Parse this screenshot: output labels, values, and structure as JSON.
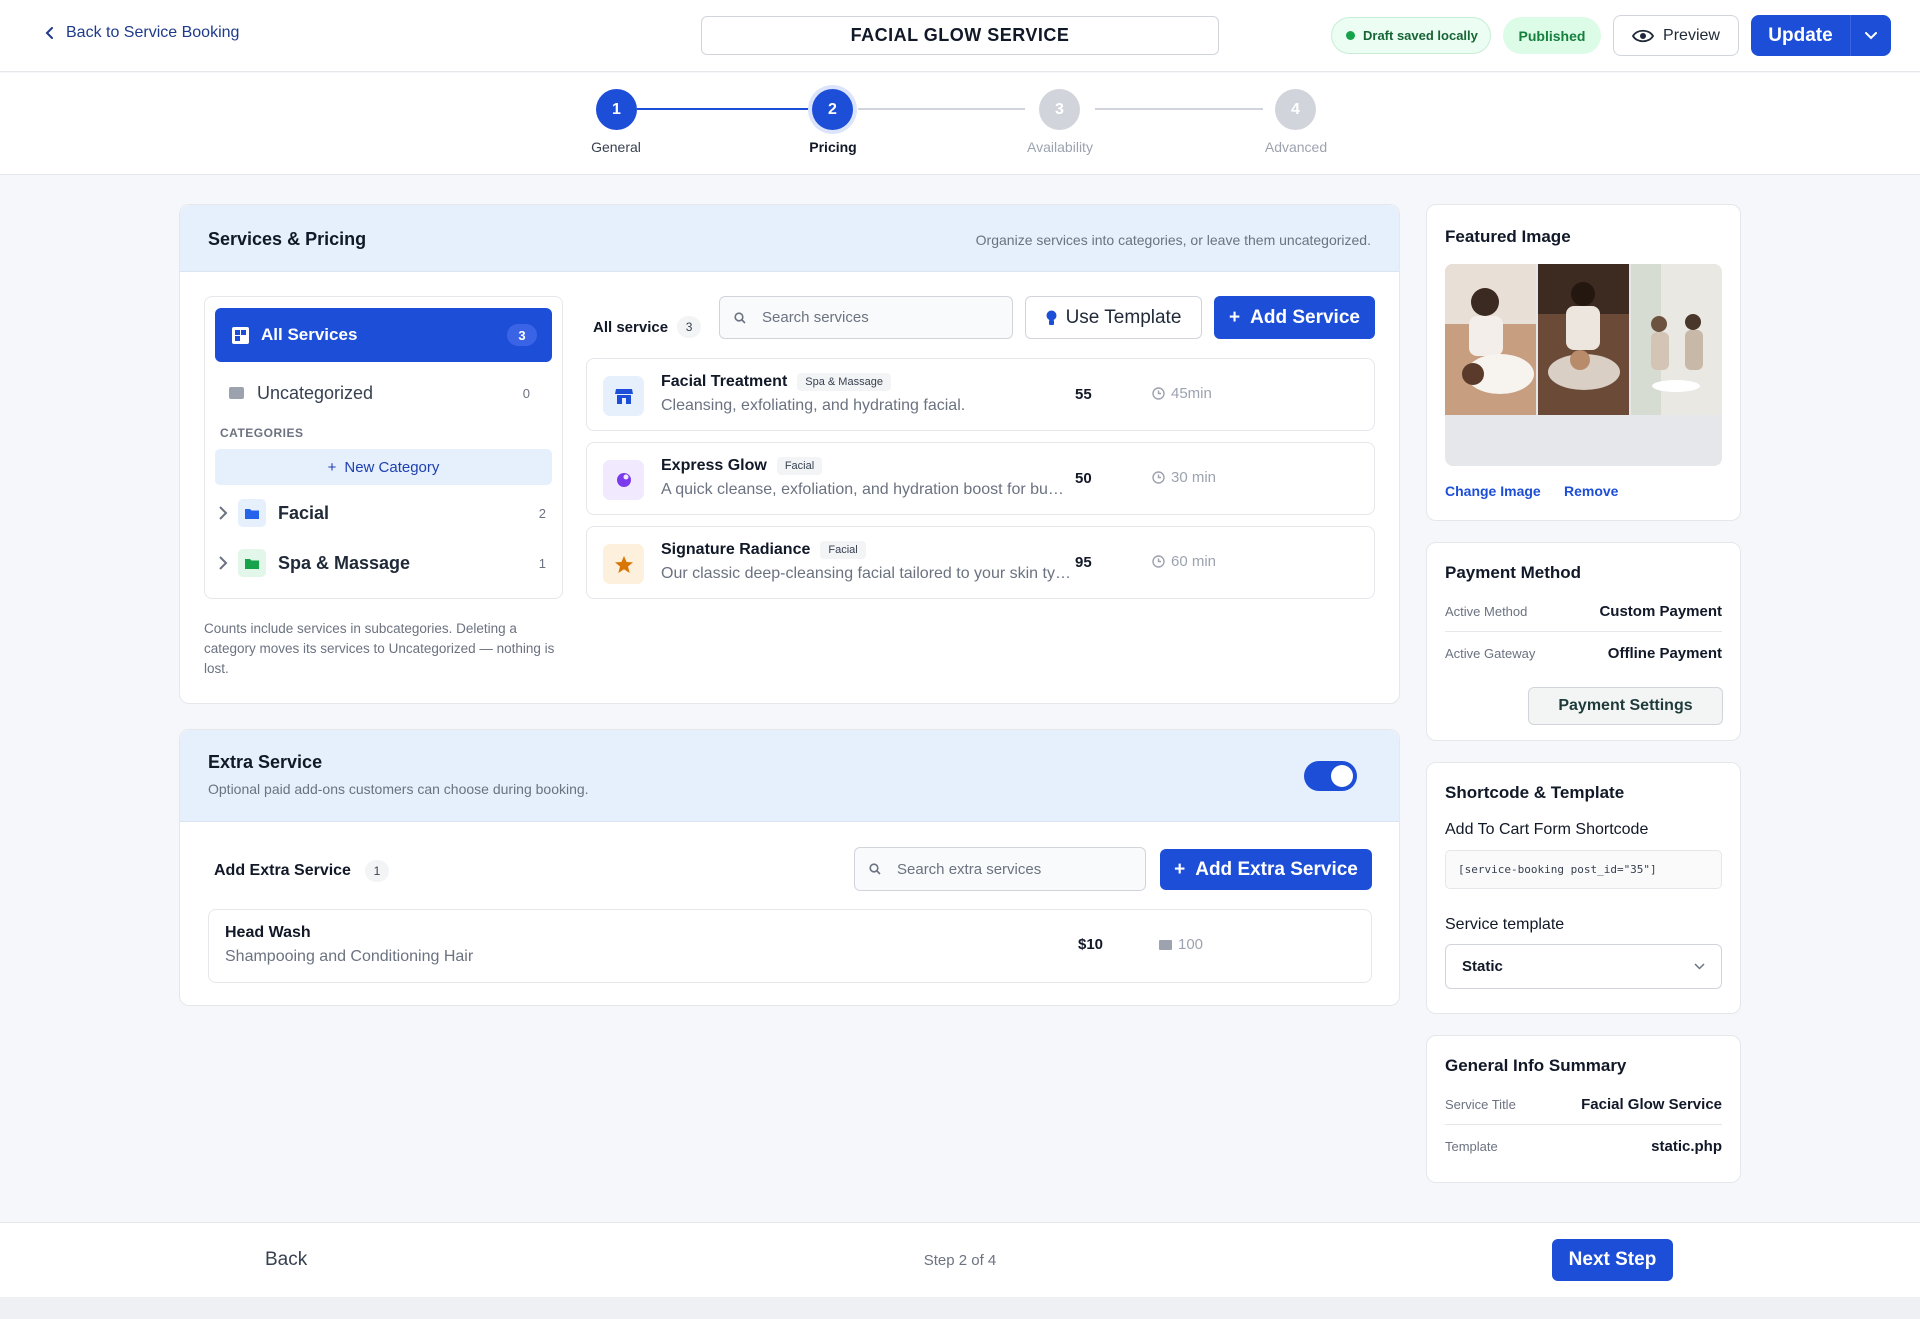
{
  "header": {
    "back_label": "Back to Service Booking",
    "title": "FACIAL GLOW SERVICE",
    "draft_status": "Draft saved locally",
    "publish_status": "Published",
    "preview_label": "Preview",
    "update_label": "Update"
  },
  "stepper": {
    "steps": [
      {
        "number": "1",
        "label": "General",
        "state": "done"
      },
      {
        "number": "2",
        "label": "Pricing",
        "state": "current"
      },
      {
        "number": "3",
        "label": "Availability",
        "state": "todo"
      },
      {
        "number": "4",
        "label": "Advanced",
        "state": "todo"
      }
    ]
  },
  "services_pricing": {
    "title": "Services & Pricing",
    "subtitle": "Organize services into categories, or leave them uncategorized.",
    "categories_panel": {
      "all_label": "All Services",
      "all_count": "3",
      "uncategorized_label": "Uncategorized",
      "uncategorized_count": "0",
      "section_label": "CATEGORIES",
      "new_category_label": "New Category",
      "items": [
        {
          "name": "Facial",
          "count": "2"
        },
        {
          "name": "Spa & Massage",
          "count": "1"
        }
      ],
      "note": "Counts include services in subcategories. Deleting a category moves its services to Uncategorized — nothing is lost."
    },
    "list_label": "All service",
    "list_count": "3",
    "search_placeholder": "Search services",
    "use_template_label": "Use Template",
    "add_service_label": "Add Service",
    "services": [
      {
        "name": "Facial Treatment",
        "tag": "Spa & Massage",
        "description": "Cleansing, exfoliating, and hydrating facial.",
        "price": "55",
        "duration": "45min",
        "icon": "store-icon"
      },
      {
        "name": "Express Glow",
        "tag": "Facial",
        "description": "A quick cleanse, exfoliation, and hydration boost for busy days.",
        "price": "50",
        "duration": "30 min",
        "icon": "glow-icon"
      },
      {
        "name": "Signature Radiance",
        "tag": "Facial",
        "description": "Our classic deep-cleansing facial tailored to your skin type.",
        "price": "95",
        "duration": "60 min",
        "icon": "star-icon"
      }
    ]
  },
  "extra_service": {
    "title": "Extra Service",
    "subtitle": "Optional paid add-ons customers can choose during booking.",
    "enabled": true,
    "list_label": "Add Extra Service",
    "list_count": "1",
    "search_placeholder": "Search extra services",
    "add_label": "Add Extra Service",
    "items": [
      {
        "name": "Head Wash",
        "description": "Shampooing and Conditioning Hair",
        "price": "$10",
        "quantity": "100"
      }
    ]
  },
  "featured_image": {
    "title": "Featured Image",
    "change_label": "Change Image",
    "remove_label": "Remove"
  },
  "payment_method": {
    "title": "Payment Method",
    "rows": [
      {
        "key": "Active Method",
        "value": "Custom Payment"
      },
      {
        "key": "Active Gateway",
        "value": "Offline Payment"
      }
    ],
    "settings_label": "Payment Settings"
  },
  "shortcode": {
    "title": "Shortcode & Template",
    "cart_label": "Add To Cart Form Shortcode",
    "code": "[service-booking post_id=\"35\"]",
    "template_label": "Service template",
    "template_value": "Static"
  },
  "general_summary": {
    "title": "General Info Summary",
    "rows": [
      {
        "key": "Service Title",
        "value": "Facial Glow Service"
      },
      {
        "key": "Template",
        "value": "static.php"
      }
    ]
  },
  "footer": {
    "back_label": "Back",
    "step_text": "Step 2 of 4",
    "next_label": "Next Step"
  },
  "colors": {
    "primary": "#1d4ed8",
    "header_tint": "#e6effc",
    "success": "#16a34a"
  }
}
